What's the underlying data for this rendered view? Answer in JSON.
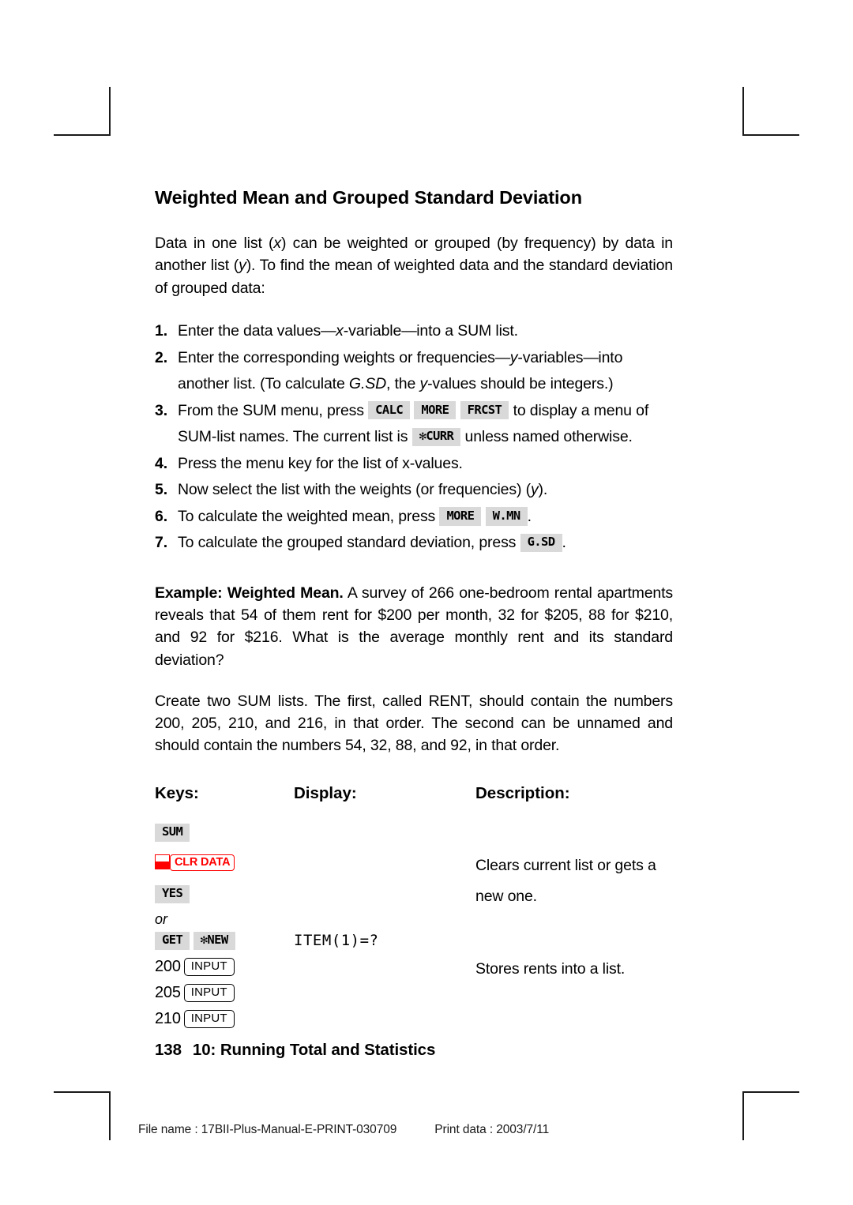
{
  "title": "Weighted Mean and Grouped Standard Deviation",
  "intro": {
    "p1_a": "Data in one list (",
    "p1_x": "x",
    "p1_b": ") can be weighted or grouped (by frequency) by data in another list (",
    "p1_y": "y",
    "p1_c": "). To find the mean of weighted data and the standard deviation of grouped data:"
  },
  "steps": [
    {
      "num": "1.",
      "a": "Enter the data values",
      "dash1": "—",
      "var1": "x",
      "b": "-variable",
      "dash2": "—",
      "c": "into a SUM list."
    },
    {
      "num": "2.",
      "a": "Enter the corresponding weights or frequencies",
      "dash1": "—",
      "var1": "y",
      "b": "-variables",
      "dash2": "—",
      "c": "into another list. (To calculate ",
      "italic2": "G.SD",
      "d": ", the ",
      "var2": "y",
      "e": "-values should be integers.)"
    },
    {
      "num": "3.",
      "a": "From the SUM menu, press",
      "key1": "CALC",
      "key2": "MORE",
      "key3": "FRCST",
      "b": "to display a menu of SUM-list names. The current list is",
      "key4": "✻CURR",
      "c": "unless named otherwise."
    },
    {
      "num": "4.",
      "a": "Press the menu key for the list of x-values."
    },
    {
      "num": "5.",
      "a": "Now select the list with the weights (or frequencies) (",
      "var1": "y",
      "b": ")."
    },
    {
      "num": "6.",
      "a": "To calculate the weighted mean, press",
      "key1": "MORE",
      "key2": "W.MN",
      "b": "."
    },
    {
      "num": "7.",
      "a": "To calculate the grouped standard deviation, press",
      "key1": "G.SD",
      "b": "."
    }
  ],
  "example": {
    "lead": "Example: Weighted Mean.",
    "text": " A survey of 266 one-bedroom rental apartments reveals that 54 of them rent for $200 per month, 32 for $205, 88 for $210, and 92 for $216. What is the average monthly rent and its standard deviation?"
  },
  "create_lists": "Create two SUM lists. The first, called RENT, should contain the numbers 200, 205, 210, and 216, in that order. The second can be unnamed and should contain the numbers 54, 32, 88, and 92, in that order.",
  "keytable": {
    "headers": {
      "keys": "Keys:",
      "display": "Display:",
      "description": "Description:"
    },
    "rows": [
      {
        "keys": [
          "SUM"
        ],
        "display": "",
        "description": ""
      },
      {
        "shift": true,
        "red_key": "CLR DATA",
        "display": "",
        "description": "Clears current list or gets a"
      },
      {
        "keys": [
          "YES"
        ],
        "display": "",
        "description": "new one."
      },
      {
        "or_label": "or",
        "display": "",
        "description": ""
      },
      {
        "keys": [
          "GET",
          "✻NEW"
        ],
        "display": "ITEM(1)=?",
        "description": ""
      },
      {
        "number": "200",
        "hard_key": "INPUT",
        "display": "",
        "description": "Stores rents into a list."
      },
      {
        "number": "205",
        "hard_key": "INPUT",
        "display": "",
        "description": ""
      },
      {
        "number": "210",
        "hard_key": "INPUT",
        "display": "",
        "description": ""
      }
    ]
  },
  "page_footer": {
    "page_number": "138",
    "chapter": "10: Running Total and Statistics"
  },
  "print_line": {
    "file_name": "File name : 17BII-Plus-Manual-E-PRINT-030709",
    "print_data": "Print data : 2003/7/11"
  },
  "colors": {
    "key_gray": "#d9d9d9",
    "shift_red": "#ff0000",
    "text_black": "#000000"
  }
}
